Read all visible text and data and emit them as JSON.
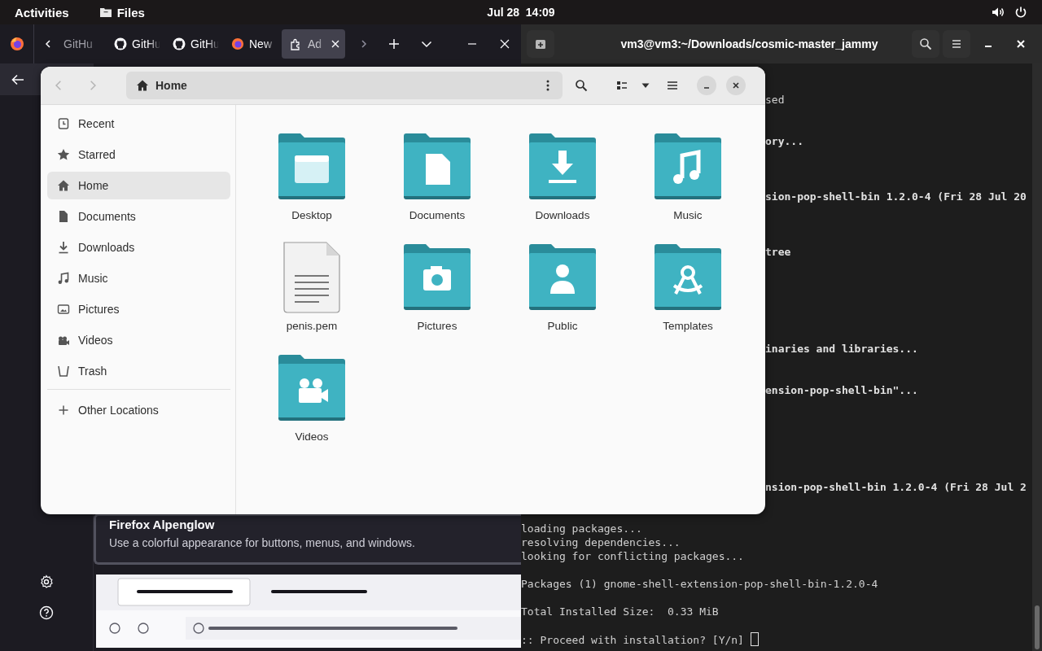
{
  "top_bar": {
    "activities": "Activities",
    "app_menu": "Files",
    "clock": "Jul 28  14:09"
  },
  "browser": {
    "tabs": [
      {
        "label": "GitHu",
        "kind": "partial",
        "selected": false
      },
      {
        "label": "GitHu",
        "kind": "github",
        "selected": false
      },
      {
        "label": "GitHu",
        "kind": "github",
        "selected": false
      },
      {
        "label": "New",
        "kind": "firefox",
        "selected": false
      },
      {
        "label": "Ad",
        "kind": "addons",
        "selected": true
      }
    ],
    "theme_card": {
      "title": "Firefox Alpenglow",
      "description": "Use a colorful appearance for buttons, menus, and windows."
    }
  },
  "terminal": {
    "title": "vm3@vm3:~/Downloads/cosmic-master_jammy",
    "lines": [
      {
        "kind": "covered",
        "text": "sed",
        "bold": false
      },
      {
        "kind": "blank"
      },
      {
        "kind": "blank"
      },
      {
        "kind": "covered",
        "text": "ory...",
        "bold": true
      },
      {
        "kind": "blank"
      },
      {
        "kind": "blank"
      },
      {
        "kind": "blank"
      },
      {
        "kind": "covered",
        "text": "sion-pop-shell-bin 1.2.0-4 (Fri 28 Jul 20",
        "bold": true
      },
      {
        "kind": "blank"
      },
      {
        "kind": "blank"
      },
      {
        "kind": "blank"
      },
      {
        "kind": "covered",
        "text": "tree",
        "bold": true
      },
      {
        "kind": "blank"
      },
      {
        "kind": "blank"
      },
      {
        "kind": "blank"
      },
      {
        "kind": "blank"
      },
      {
        "kind": "blank"
      },
      {
        "kind": "blank"
      },
      {
        "kind": "covered",
        "text": "inaries and libraries...",
        "bold": true
      },
      {
        "kind": "blank"
      },
      {
        "kind": "blank"
      },
      {
        "kind": "covered",
        "text": "ension-pop-shell-bin\"...",
        "bold": true
      },
      {
        "kind": "blank"
      },
      {
        "kind": "blank"
      },
      {
        "kind": "blank"
      },
      {
        "kind": "blank"
      },
      {
        "kind": "blank"
      },
      {
        "kind": "blank"
      },
      {
        "kind": "covered",
        "text": "nsion-pop-shell-bin 1.2.0-4 (Fri 28 Jul 2",
        "bold": true
      },
      {
        "kind": "blank"
      },
      {
        "kind": "blank"
      },
      {
        "kind": "plain",
        "text": "loading packages..."
      },
      {
        "kind": "plain",
        "text": "resolving dependencies..."
      },
      {
        "kind": "plain",
        "text": "looking for conflicting packages..."
      },
      {
        "kind": "blank"
      },
      {
        "kind": "plain",
        "text": "Packages (1) gnome-shell-extension-pop-shell-bin-1.2.0-4"
      },
      {
        "kind": "blank"
      },
      {
        "kind": "plain",
        "text": "Total Installed Size:  0.33 MiB"
      },
      {
        "kind": "blank"
      },
      {
        "kind": "prompt",
        "text": ":: Proceed with installation? [Y/n]"
      }
    ]
  },
  "files": {
    "back": {
      "disabled": true
    },
    "forward": {
      "disabled": true
    },
    "path": "Home",
    "sidebar": [
      {
        "label": "Recent",
        "kind": "recent",
        "selected": false
      },
      {
        "label": "Starred",
        "kind": "starred",
        "selected": false
      },
      {
        "label": "Home",
        "kind": "home",
        "selected": true
      },
      {
        "label": "Documents",
        "kind": "documents",
        "selected": false
      },
      {
        "label": "Downloads",
        "kind": "downloads",
        "selected": false
      },
      {
        "label": "Music",
        "kind": "music",
        "selected": false
      },
      {
        "label": "Pictures",
        "kind": "pictures",
        "selected": false
      },
      {
        "label": "Videos",
        "kind": "videos",
        "selected": false
      },
      {
        "label": "Trash",
        "kind": "trash",
        "selected": false
      }
    ],
    "other_locations": "Other Locations",
    "items": [
      {
        "name": "Desktop",
        "kind": "desktop"
      },
      {
        "name": "Documents",
        "kind": "documents"
      },
      {
        "name": "Downloads",
        "kind": "downloads"
      },
      {
        "name": "Music",
        "kind": "music"
      },
      {
        "name": "penis.pem",
        "kind": "file"
      },
      {
        "name": "Pictures",
        "kind": "pictures"
      },
      {
        "name": "Public",
        "kind": "public"
      },
      {
        "name": "Templates",
        "kind": "templates"
      },
      {
        "name": "Videos",
        "kind": "videos"
      }
    ]
  }
}
